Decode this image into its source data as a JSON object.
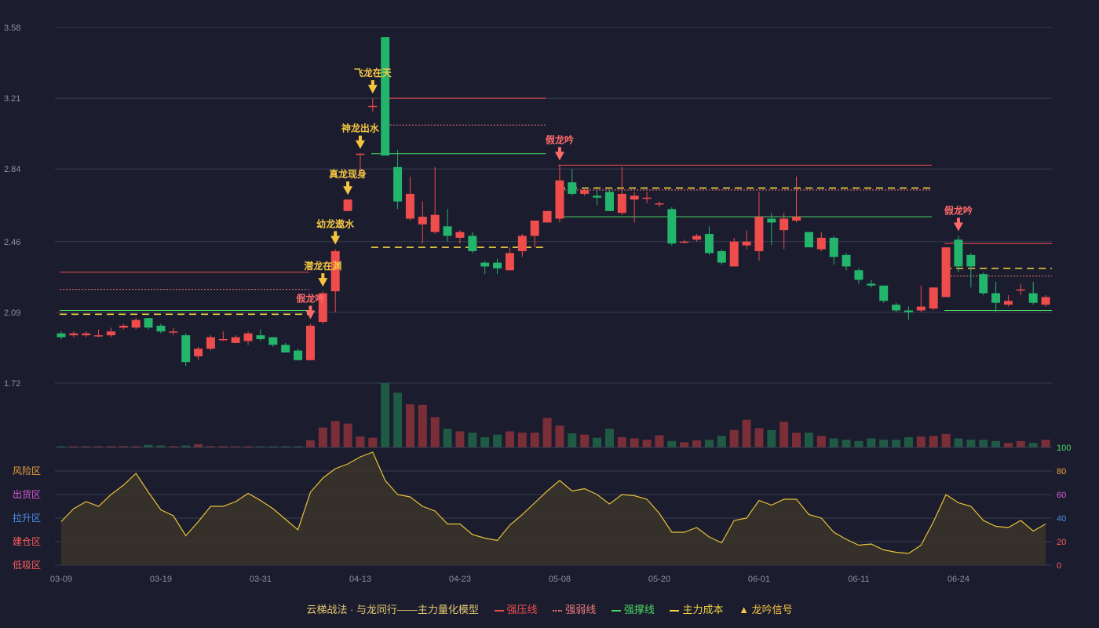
{
  "chart_data": {
    "type": "candlestick",
    "price_axis": {
      "ticks": [
        "3.58",
        "3.21",
        "2.84",
        "2.46",
        "2.09",
        "1.72"
      ],
      "min": 1.72,
      "max": 3.58
    },
    "x_tick_labels": [
      "03-09",
      "03-19",
      "03-31",
      "04-13",
      "04-23",
      "05-08",
      "05-20",
      "06-01",
      "06-11",
      "06-24"
    ],
    "x_tick_bar_index": [
      0,
      8,
      16,
      24,
      32,
      40,
      48,
      56,
      64,
      72
    ],
    "candles": [
      {
        "o": 1.98,
        "c": 1.96,
        "h": 1.99,
        "l": 1.95
      },
      {
        "o": 1.97,
        "c": 1.98,
        "h": 1.99,
        "l": 1.96
      },
      {
        "o": 1.97,
        "c": 1.98,
        "h": 1.99,
        "l": 1.96
      },
      {
        "o": 1.97,
        "c": 1.97,
        "h": 2.0,
        "l": 1.96
      },
      {
        "o": 1.97,
        "c": 1.99,
        "h": 2.01,
        "l": 1.96
      },
      {
        "o": 2.01,
        "c": 2.02,
        "h": 2.03,
        "l": 2.0
      },
      {
        "o": 2.01,
        "c": 2.05,
        "h": 2.06,
        "l": 2.0
      },
      {
        "o": 2.06,
        "c": 2.01,
        "h": 2.06,
        "l": 2.0
      },
      {
        "o": 2.02,
        "c": 1.99,
        "h": 2.03,
        "l": 1.98
      },
      {
        "o": 1.99,
        "c": 1.99,
        "h": 2.01,
        "l": 1.97
      },
      {
        "o": 1.97,
        "c": 1.83,
        "h": 1.98,
        "l": 1.81
      },
      {
        "o": 1.86,
        "c": 1.9,
        "h": 1.91,
        "l": 1.84
      },
      {
        "o": 1.9,
        "c": 1.96,
        "h": 1.97,
        "l": 1.89
      },
      {
        "o": 1.95,
        "c": 1.95,
        "h": 1.99,
        "l": 1.94
      },
      {
        "o": 1.93,
        "c": 1.96,
        "h": 1.97,
        "l": 1.93
      },
      {
        "o": 1.94,
        "c": 1.98,
        "h": 1.99,
        "l": 1.92
      },
      {
        "o": 1.97,
        "c": 1.95,
        "h": 2.0,
        "l": 1.94
      },
      {
        "o": 1.96,
        "c": 1.92,
        "h": 1.96,
        "l": 1.91
      },
      {
        "o": 1.92,
        "c": 1.88,
        "h": 1.93,
        "l": 1.88
      },
      {
        "o": 1.89,
        "c": 1.84,
        "h": 1.9,
        "l": 1.84
      },
      {
        "o": 1.84,
        "c": 2.02,
        "h": 2.03,
        "l": 1.84
      },
      {
        "o": 2.04,
        "c": 2.19,
        "h": 2.2,
        "l": 2.03
      },
      {
        "o": 2.2,
        "c": 2.41,
        "h": 2.42,
        "l": 2.09
      },
      {
        "o": 2.62,
        "c": 2.68,
        "h": 2.68,
        "l": 2.62
      },
      {
        "o": 2.92,
        "c": 2.92,
        "h": 2.92,
        "l": 2.82
      },
      {
        "o": 3.17,
        "c": 3.17,
        "h": 3.21,
        "l": 3.14
      },
      {
        "o": 3.53,
        "c": 2.91,
        "h": 3.53,
        "l": 2.91
      },
      {
        "o": 2.85,
        "c": 2.67,
        "h": 2.94,
        "l": 2.63
      },
      {
        "o": 2.58,
        "c": 2.71,
        "h": 2.8,
        "l": 2.57
      },
      {
        "o": 2.55,
        "c": 2.59,
        "h": 2.67,
        "l": 2.45
      },
      {
        "o": 2.51,
        "c": 2.6,
        "h": 2.85,
        "l": 2.5
      },
      {
        "o": 2.54,
        "c": 2.49,
        "h": 2.63,
        "l": 2.46
      },
      {
        "o": 2.48,
        "c": 2.51,
        "h": 2.52,
        "l": 2.45
      },
      {
        "o": 2.49,
        "c": 2.41,
        "h": 2.51,
        "l": 2.4
      },
      {
        "o": 2.35,
        "c": 2.33,
        "h": 2.36,
        "l": 2.29
      },
      {
        "o": 2.35,
        "c": 2.32,
        "h": 2.37,
        "l": 2.29
      },
      {
        "o": 2.31,
        "c": 2.4,
        "h": 2.43,
        "l": 2.31
      },
      {
        "o": 2.41,
        "c": 2.49,
        "h": 2.5,
        "l": 2.38
      },
      {
        "o": 2.49,
        "c": 2.57,
        "h": 2.57,
        "l": 2.43
      },
      {
        "o": 2.56,
        "c": 2.62,
        "h": 2.62,
        "l": 2.56
      },
      {
        "o": 2.58,
        "c": 2.78,
        "h": 2.86,
        "l": 2.56
      },
      {
        "o": 2.77,
        "c": 2.71,
        "h": 2.84,
        "l": 2.7
      },
      {
        "o": 2.71,
        "c": 2.73,
        "h": 2.74,
        "l": 2.7
      },
      {
        "o": 2.7,
        "c": 2.69,
        "h": 2.73,
        "l": 2.65
      },
      {
        "o": 2.72,
        "c": 2.62,
        "h": 2.73,
        "l": 2.62
      },
      {
        "o": 2.61,
        "c": 2.71,
        "h": 2.85,
        "l": 2.6
      },
      {
        "o": 2.68,
        "c": 2.7,
        "h": 2.72,
        "l": 2.56
      },
      {
        "o": 2.69,
        "c": 2.69,
        "h": 2.72,
        "l": 2.66
      },
      {
        "o": 2.66,
        "c": 2.66,
        "h": 2.67,
        "l": 2.64
      },
      {
        "o": 2.63,
        "c": 2.45,
        "h": 2.64,
        "l": 2.44
      },
      {
        "o": 2.46,
        "c": 2.46,
        "h": 2.47,
        "l": 2.45
      },
      {
        "o": 2.47,
        "c": 2.49,
        "h": 2.5,
        "l": 2.46
      },
      {
        "o": 2.5,
        "c": 2.4,
        "h": 2.54,
        "l": 2.39
      },
      {
        "o": 2.41,
        "c": 2.35,
        "h": 2.42,
        "l": 2.34
      },
      {
        "o": 2.33,
        "c": 2.46,
        "h": 2.48,
        "l": 2.33
      },
      {
        "o": 2.44,
        "c": 2.46,
        "h": 2.52,
        "l": 2.42
      },
      {
        "o": 2.41,
        "c": 2.59,
        "h": 2.72,
        "l": 2.36
      },
      {
        "o": 2.58,
        "c": 2.56,
        "h": 2.61,
        "l": 2.44
      },
      {
        "o": 2.52,
        "c": 2.58,
        "h": 2.61,
        "l": 2.42
      },
      {
        "o": 2.57,
        "c": 2.59,
        "h": 2.8,
        "l": 2.56
      },
      {
        "o": 2.51,
        "c": 2.43,
        "h": 2.51,
        "l": 2.43
      },
      {
        "o": 2.42,
        "c": 2.48,
        "h": 2.51,
        "l": 2.41
      },
      {
        "o": 2.48,
        "c": 2.38,
        "h": 2.49,
        "l": 2.34
      },
      {
        "o": 2.39,
        "c": 2.33,
        "h": 2.4,
        "l": 2.31
      },
      {
        "o": 2.31,
        "c": 2.26,
        "h": 2.32,
        "l": 2.24
      },
      {
        "o": 2.24,
        "c": 2.23,
        "h": 2.26,
        "l": 2.22
      },
      {
        "o": 2.23,
        "c": 2.15,
        "h": 2.23,
        "l": 2.14
      },
      {
        "o": 2.13,
        "c": 2.1,
        "h": 2.14,
        "l": 2.09
      },
      {
        "o": 2.1,
        "c": 2.09,
        "h": 2.12,
        "l": 2.05
      },
      {
        "o": 2.1,
        "c": 2.12,
        "h": 2.23,
        "l": 2.09
      },
      {
        "o": 2.11,
        "c": 2.22,
        "h": 2.22,
        "l": 2.1
      },
      {
        "o": 2.17,
        "c": 2.43,
        "h": 2.43,
        "l": 2.17
      },
      {
        "o": 2.47,
        "c": 2.33,
        "h": 2.49,
        "l": 2.3
      },
      {
        "o": 2.39,
        "c": 2.33,
        "h": 2.4,
        "l": 2.22
      },
      {
        "o": 2.29,
        "c": 2.19,
        "h": 2.3,
        "l": 2.18
      },
      {
        "o": 2.19,
        "c": 2.14,
        "h": 2.25,
        "l": 2.09
      },
      {
        "o": 2.13,
        "c": 2.15,
        "h": 2.18,
        "l": 2.12
      },
      {
        "o": 2.21,
        "c": 2.21,
        "h": 2.24,
        "l": 2.18
      },
      {
        "o": 2.19,
        "c": 2.14,
        "h": 2.25,
        "l": 2.13
      },
      {
        "o": 2.13,
        "c": 2.17,
        "h": 2.18,
        "l": 2.12
      }
    ],
    "volume": [
      1,
      1,
      1,
      1,
      2,
      2,
      2,
      4,
      3,
      2,
      3,
      5,
      2,
      2,
      1,
      1,
      1,
      1,
      1,
      1,
      11,
      31,
      41,
      37,
      17,
      15,
      100,
      85,
      67,
      66,
      47,
      29,
      25,
      23,
      16,
      20,
      25,
      23,
      23,
      46,
      34,
      22,
      20,
      15,
      29,
      16,
      14,
      12,
      19,
      10,
      8,
      11,
      12,
      18,
      27,
      43,
      30,
      27,
      40,
      23,
      23,
      18,
      14,
      12,
      10,
      14,
      12,
      12,
      16,
      17,
      18,
      21,
      14,
      12,
      12,
      10,
      7,
      10,
      7,
      12
    ],
    "oscillator": {
      "values": [
        37,
        48,
        54,
        50,
        60,
        68,
        78,
        62,
        47,
        42,
        25,
        37,
        50,
        50,
        54,
        61,
        55,
        48,
        39,
        30,
        62,
        74,
        82,
        86,
        92,
        96,
        72,
        60,
        58,
        50,
        46,
        35,
        35,
        26,
        23,
        21,
        34,
        43,
        53,
        63,
        72,
        63,
        65,
        60,
        52,
        60,
        59,
        56,
        44,
        28,
        28,
        32,
        24,
        19,
        38,
        40,
        55,
        51,
        56,
        56,
        43,
        40,
        28,
        22,
        17,
        18,
        13,
        11,
        10,
        17,
        37,
        60,
        53,
        50,
        38,
        33,
        32,
        38,
        29,
        35
      ],
      "axis_ticks": [
        0,
        20,
        40,
        60,
        80,
        100
      ],
      "zones": [
        "风险区",
        "出货区",
        "拉升区",
        "建仓区",
        "低吸区"
      ],
      "zone_colors": [
        "#e8a33a",
        "#d95bd9",
        "#4b8ee8",
        "#ff5d5d",
        "#ff5d5d"
      ]
    },
    "levels": [
      {
        "type": "strong_resistance",
        "price": 2.3,
        "from": 0,
        "to": 20,
        "style": "solid"
      },
      {
        "type": "weak_line",
        "price": 2.21,
        "from": 0,
        "to": 20,
        "style": "dotted"
      },
      {
        "type": "strong_support",
        "price": 2.1,
        "from": 0,
        "to": 20,
        "style": "solid"
      },
      {
        "type": "main_cost",
        "price": 2.08,
        "from": 0,
        "to": 20,
        "style": "dashed"
      },
      {
        "type": "strong_resistance",
        "price": 3.21,
        "from": 26,
        "to": 39,
        "style": "solid"
      },
      {
        "type": "weak_line",
        "price": 3.07,
        "from": 26,
        "to": 39,
        "style": "dotted"
      },
      {
        "type": "strong_support",
        "price": 2.92,
        "from": 25,
        "to": 39,
        "style": "solid"
      },
      {
        "type": "main_cost",
        "price": 2.43,
        "from": 25,
        "to": 39,
        "style": "dashed"
      },
      {
        "type": "strong_resistance",
        "price": 2.86,
        "from": 40,
        "to": 70,
        "style": "solid"
      },
      {
        "type": "weak_line",
        "price": 2.73,
        "from": 40,
        "to": 70,
        "style": "dotted"
      },
      {
        "type": "main_cost",
        "price": 2.74,
        "from": 40,
        "to": 70,
        "style": "dashed"
      },
      {
        "type": "strong_support",
        "price": 2.59,
        "from": 40,
        "to": 70,
        "style": "solid"
      },
      {
        "type": "strong_resistance",
        "price": 2.45,
        "from": 71,
        "to": 80,
        "style": "solid"
      },
      {
        "type": "weak_line",
        "price": 2.28,
        "from": 71,
        "to": 80,
        "style": "dotted"
      },
      {
        "type": "main_cost",
        "price": 2.32,
        "from": 71,
        "to": 80,
        "style": "dashed"
      },
      {
        "type": "strong_support",
        "price": 2.1,
        "from": 71,
        "to": 80,
        "style": "solid"
      }
    ],
    "signals": [
      {
        "bar": 20,
        "label": "假龙吟",
        "color": "#ff6b6b"
      },
      {
        "bar": 21,
        "label": "潜龙在渊",
        "color": "#f5c542"
      },
      {
        "bar": 22,
        "label": "幼龙遨水",
        "color": "#f5c542"
      },
      {
        "bar": 23,
        "label": "真龙现身",
        "color": "#f5c542"
      },
      {
        "bar": 24,
        "label": "神龙出水",
        "color": "#f5c542"
      },
      {
        "bar": 25,
        "label": "飞龙在天",
        "color": "#f5c542"
      },
      {
        "bar": 40,
        "label": "假龙吟",
        "color": "#ff6b6b"
      },
      {
        "bar": 72,
        "label": "假龙吟",
        "color": "#ff6b6b"
      }
    ],
    "colors": {
      "up": "#ef4c4c",
      "down": "#22b56b",
      "cost": "#f5d442",
      "resistance": "#ef4c4c",
      "support": "#4cd964",
      "oscillator": "#e8c23a"
    }
  },
  "legend": {
    "title": "云梯战法 · 与龙同行——主力量化模型",
    "items": [
      {
        "label": "强压线",
        "color": "#ef4c4c",
        "style": "solid"
      },
      {
        "label": "强弱线",
        "color": "#ef7a7a",
        "style": "dotted"
      },
      {
        "label": "强撑线",
        "color": "#4cd964",
        "style": "solid"
      },
      {
        "label": "主力成本",
        "color": "#f5d442",
        "style": "dashed"
      },
      {
        "label": "龙吟信号",
        "color": "#f5c542",
        "style": "triangle"
      }
    ]
  }
}
